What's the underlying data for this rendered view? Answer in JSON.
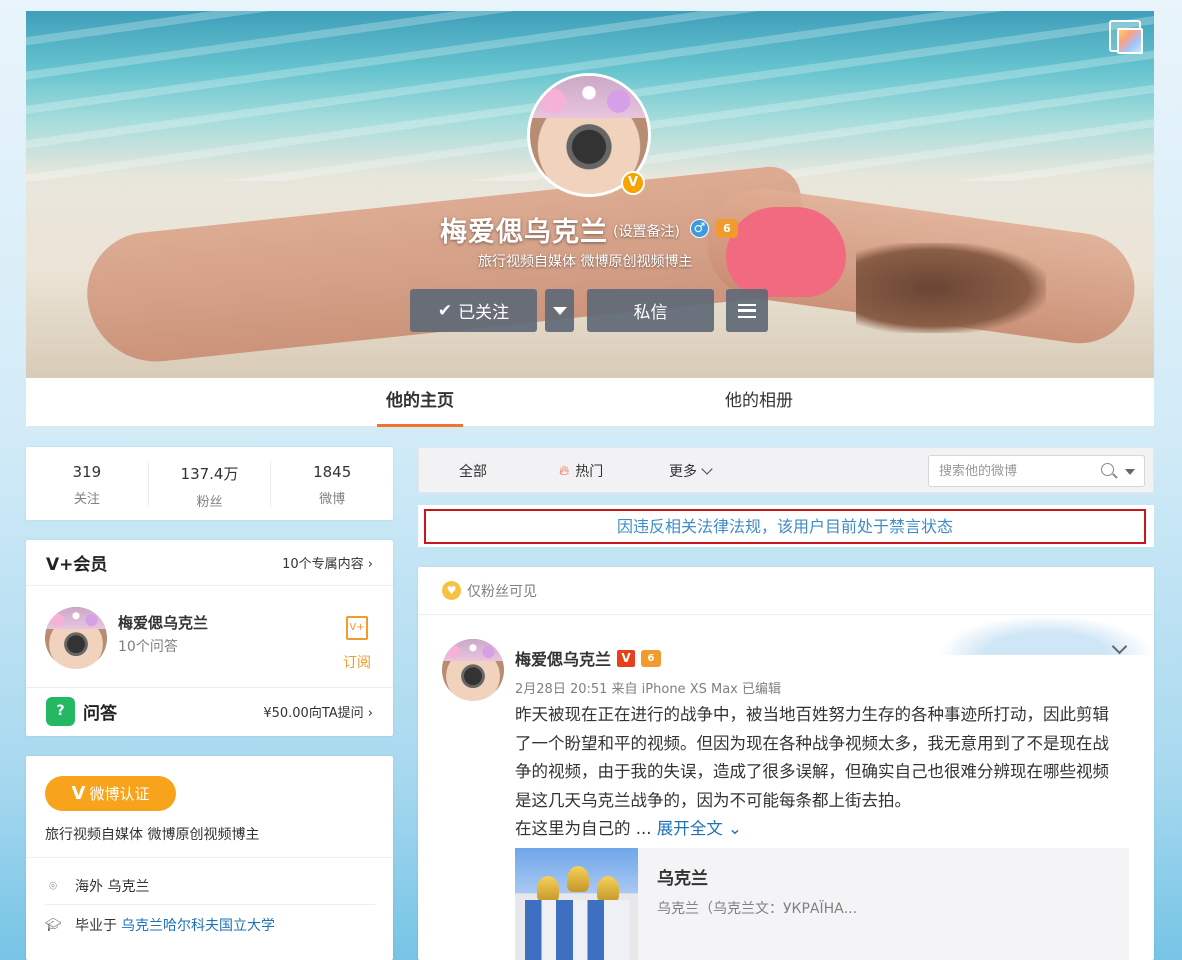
{
  "cover": {
    "name": "梅爱偲乌克兰",
    "remark": "(设置备注)",
    "verified_badge": "V",
    "level_badge": "6",
    "description": "旅行视频自媒体 微博原创视频博主",
    "buttons": {
      "followed": "已关注",
      "message": "私信"
    }
  },
  "tabs": [
    "他的主页",
    "他的相册"
  ],
  "stats": [
    {
      "value": "319",
      "label": "关注"
    },
    {
      "value": "137.4万",
      "label": "粉丝"
    },
    {
      "value": "1845",
      "label": "微博"
    }
  ],
  "vip": {
    "title": "V+会员",
    "more": "10个专属内容 ›",
    "member_name": "梅爱偲乌克兰",
    "member_sub": "10个问答",
    "subscribe": "订阅",
    "qa_title": "问答",
    "qa_price": "¥50.00向TA提问 ›"
  },
  "info": {
    "verify_badge": "微博认证",
    "verify_desc": "旅行视频自媒体 微博原创视频博主",
    "location_prefix": "海外 乌克兰",
    "school_prefix": "毕业于",
    "school": "乌克兰哈尔科夫国立大学"
  },
  "filter": {
    "all": "全部",
    "hot": "热门",
    "more": "更多",
    "search_placeholder": "搜索他的微博"
  },
  "ban_notice": "因违反相关法律法规，该用户目前处于禁言状态",
  "post": {
    "visibility": "仅粉丝可见",
    "author": "梅爱偲乌克兰",
    "meta": "2月28日 20:51  来自 iPhone XS Max  已编辑",
    "text": "昨天被现在正在进行的战争中，被当地百姓努力生存的各种事迹所打动，因此剪辑了一个盼望和平的视频。但因为现在各种战争视频太多，我无意用到了不是现在战争的视频，由于我的失误，造成了很多误解，但确实自己也很难分辨现在哪些视频是这几天乌克兰战争的，因为不可能每条都上街去拍。",
    "more_prefix": "在这里为自己的 ...",
    "expand": "展开全文",
    "attachment_title": "乌克兰",
    "attachment_desc": "乌克兰（乌克兰文：УКРАЇНА..."
  },
  "colors": {
    "accent_orange": "#f3722c",
    "link_blue": "#1d72b8",
    "notice_red": "#c8161d"
  }
}
